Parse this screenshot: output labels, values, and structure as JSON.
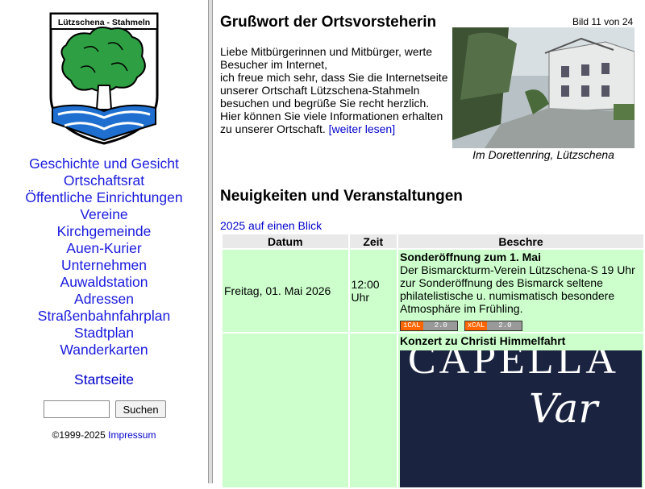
{
  "sidebar": {
    "crest_banner": "Lützschena - Stahmeln",
    "nav": [
      "Geschichte und Gesicht",
      "Ortschaftsrat",
      "Öffentliche Einrichtungen",
      "Vereine",
      "Kirchgemeinde",
      "Auen-Kurier",
      "Unternehmen",
      "Auwaldstation",
      "Adressen",
      "Straßenbahnfahrplan",
      "Stadtplan",
      "Wanderkarten"
    ],
    "home": "Startseite",
    "search_button": "Suchen",
    "copyright": "©1999-2025",
    "impressum": "Impressum"
  },
  "greeting": {
    "title": "Grußwort der Ortsvorsteherin",
    "line1": "Liebe Mitbürgerinnen und Mitbürger, werte Besucher im Internet,",
    "line2": "ich freue mich sehr, dass Sie die Internetseite unserer Ortschaft Lützschena-Stahmeln besuchen und begrüße Sie recht herzlich. Hier können Sie viele Informationen erhalten zu unserer Ortschaft.",
    "more": "[weiter lesen]"
  },
  "gallery": {
    "counter": "Bild 11 von 24",
    "caption": "Im Dorettenring, Lützschena"
  },
  "news": {
    "title": "Neuigkeiten und Veranstaltungen",
    "year_link": "2025 auf einen Blick",
    "headers": {
      "date": "Datum",
      "time": "Zeit",
      "desc": "Beschre"
    },
    "events": [
      {
        "date": "Freitag, 01. Mai 2026",
        "time": "12:00 Uhr",
        "title": "Sonderöffnung zum 1. Mai",
        "text": "Der Bismarckturm-Verein Lützschena-S 19 Uhr zur Sonderöffnung des Bismarck seltene philatelistische u. numismatisch besondere Atmosphäre im Frühling.",
        "badge_ical": "iCAL",
        "badge_xcal": "xCAL",
        "badge_version": "2.0"
      },
      {
        "date": "",
        "time": "",
        "title": "Konzert zu Christi Himmelfahrt",
        "poster_line1": "CAPELLA",
        "poster_line2": "Var"
      }
    ]
  },
  "colors": {
    "link": "#1a1add",
    "event_bg": "#ccffcc",
    "header_bg": "#e9e9e9",
    "divider": "#dcdcdc"
  }
}
